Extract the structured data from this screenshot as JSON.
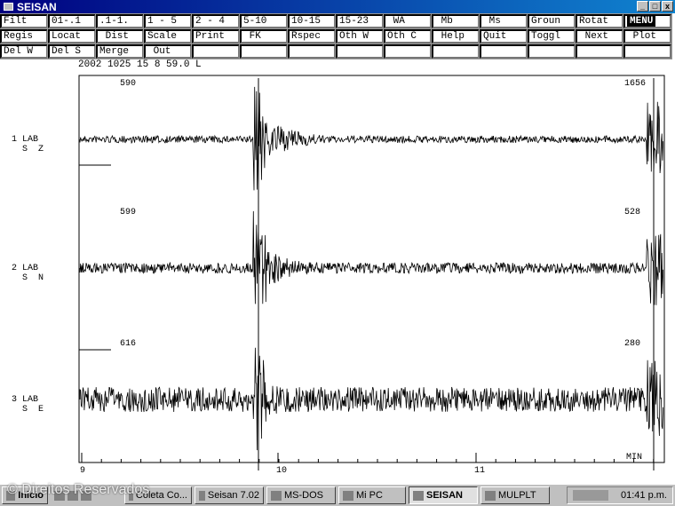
{
  "window": {
    "title": "SEISAN",
    "controls": [
      "_",
      "□",
      "x"
    ]
  },
  "menu": {
    "rows": [
      [
        "Filt",
        "01-.1",
        ".1-1.",
        "1 - 5",
        "2 - 4",
        "5-10",
        "10-15",
        "15-23",
        " WA",
        " Mb",
        " Ms",
        "Groun",
        "Rotat",
        "MENU"
      ],
      [
        "Regis",
        "Locat",
        " Dist",
        "Scale",
        "Print",
        " FK",
        "Rspec",
        "Oth W",
        "Oth C",
        " Help",
        "Quit",
        "Toggl",
        " Next",
        " Plot"
      ],
      [
        "Del W",
        "Del S",
        "Merge",
        " Out",
        "",
        "",
        "",
        "",
        "",
        "",
        "",
        "",
        "",
        ""
      ]
    ],
    "selected": "MENU"
  },
  "header": {
    "datetime": "2002 1025 15 8 59.0 L"
  },
  "traces": [
    {
      "label": "1 LAB\n  S  Z",
      "amp_left": "590",
      "amp_right": "1656"
    },
    {
      "label": "2 LAB\n  S  N",
      "amp_left": "599",
      "amp_right": "528"
    },
    {
      "label": "3 LAB\n  S  E",
      "amp_left": "616",
      "amp_right": "280"
    }
  ],
  "xaxis": {
    "ticks": [
      "9",
      "10",
      "11"
    ],
    "unit": "MIN"
  },
  "taskbar": {
    "start": "Inicio",
    "items": [
      "Coleta Co...",
      "Seisan 7.02",
      "MS-DOS",
      "Mi PC",
      "SEISAN",
      "MULPLT"
    ],
    "active": "SEISAN",
    "clock": "01:41 p.m."
  },
  "watermark": "© Direitos Reservados"
}
